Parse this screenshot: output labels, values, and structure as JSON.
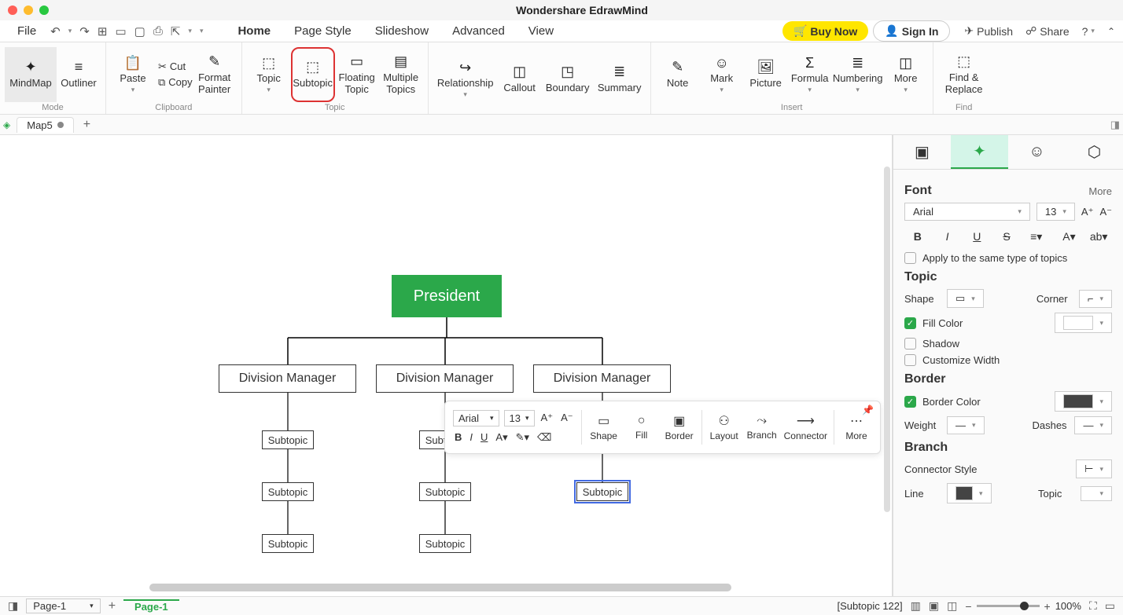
{
  "title": "Wondershare EdrawMind",
  "menubar": {
    "file": "File",
    "items": [
      "Home",
      "Page Style",
      "Slideshow",
      "Advanced",
      "View"
    ],
    "buy_now": "Buy Now",
    "sign_in": "Sign In",
    "publish": "Publish",
    "share": "Share"
  },
  "ribbon": {
    "mindmap": "MindMap",
    "outliner": "Outliner",
    "paste": "Paste",
    "cut": "Cut",
    "copy": "Copy",
    "format_painter": "Format\nPainter",
    "topic": "Topic",
    "subtopic": "Subtopic",
    "floating_topic": "Floating\nTopic",
    "multiple_topics": "Multiple\nTopics",
    "relationship": "Relationship",
    "callout": "Callout",
    "boundary": "Boundary",
    "summary": "Summary",
    "note": "Note",
    "mark": "Mark",
    "picture": "Picture",
    "formula": "Formula",
    "numbering": "Numbering",
    "more": "More",
    "find_replace": "Find &\nReplace",
    "groups": {
      "mode": "Mode",
      "clipboard": "Clipboard",
      "topic": "Topic",
      "insert": "Insert",
      "find": "Find"
    }
  },
  "doc_tab": {
    "name": "Map5"
  },
  "chart": {
    "president": "President",
    "manager": "Division Manager",
    "subtopic": "Subtopic"
  },
  "float_toolbar": {
    "font": "Arial",
    "size": "13",
    "shape": "Shape",
    "fill": "Fill",
    "border": "Border",
    "layout": "Layout",
    "branch": "Branch",
    "connector": "Connector",
    "more": "More"
  },
  "panel": {
    "font": "Font",
    "more": "More",
    "font_name": "Arial",
    "font_size": "13",
    "apply_same": "Apply to the same type of topics",
    "topic": "Topic",
    "shape": "Shape",
    "corner": "Corner",
    "fill_color": "Fill Color",
    "shadow": "Shadow",
    "customize_width": "Customize Width",
    "border": "Border",
    "border_color": "Border Color",
    "weight": "Weight",
    "dashes": "Dashes",
    "branch": "Branch",
    "connector_style": "Connector Style",
    "line": "Line",
    "topic2": "Topic"
  },
  "bottom": {
    "page": "Page-1",
    "status": "[Subtopic 122]",
    "zoom": "100%"
  }
}
